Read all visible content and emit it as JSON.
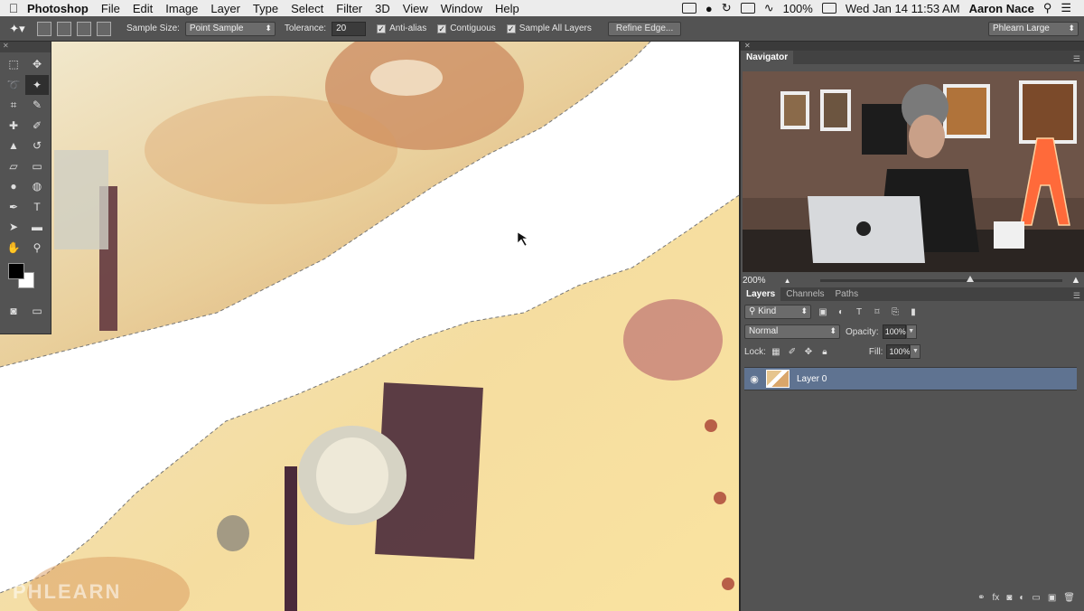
{
  "menubar": {
    "app_name": "Photoshop",
    "menus": [
      "File",
      "Edit",
      "Image",
      "Layer",
      "Type",
      "Select",
      "Filter",
      "3D",
      "View",
      "Window",
      "Help"
    ],
    "battery": "100%",
    "datetime": "Wed Jan 14  11:53 AM",
    "user": "Aaron Nace"
  },
  "options": {
    "sample_size_label": "Sample Size:",
    "sample_size_value": "Point Sample",
    "tolerance_label": "Tolerance:",
    "tolerance_value": "20",
    "anti_alias": "Anti-alias",
    "contiguous": "Contiguous",
    "sample_all_layers": "Sample All Layers",
    "refine_edge": "Refine Edge...",
    "workspace": "Phlearn Large"
  },
  "canvas": {
    "watermark": "PHLEARN"
  },
  "navigator": {
    "title": "Navigator",
    "zoom": "200%",
    "zoom_level": 0.62
  },
  "layers_panel": {
    "tabs": [
      "Layers",
      "Channels",
      "Paths"
    ],
    "kind_label": "Kind",
    "blend_mode": "Normal",
    "opacity_label": "Opacity:",
    "opacity_value": "100%",
    "lock_label": "Lock:",
    "fill_label": "Fill:",
    "fill_value": "100%",
    "layers": [
      {
        "name": "Layer 0",
        "visible": true,
        "selected": true
      }
    ]
  },
  "colors": {
    "foreground": "#000000",
    "background": "#ffffff",
    "selected_layer": "#5f7391"
  }
}
